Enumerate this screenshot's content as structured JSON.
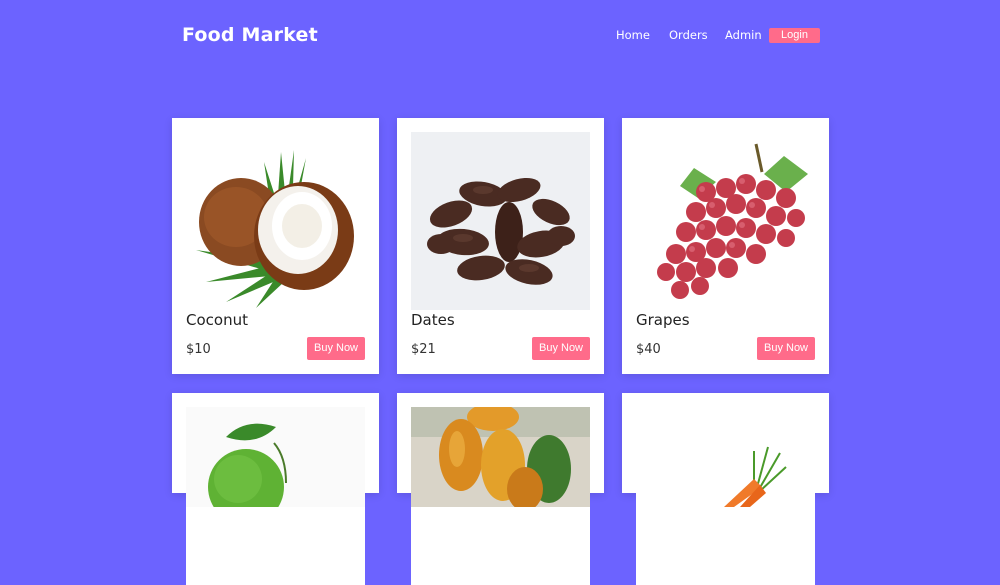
{
  "brand": "Food Market",
  "nav": {
    "home": "Home",
    "orders": "Orders",
    "admin": "Admin",
    "login": "Login"
  },
  "colors": {
    "background": "#6c63ff",
    "accent": "#ff6b8a",
    "card": "#ffffff"
  },
  "products": [
    {
      "name": "Coconut",
      "price": "$10",
      "button": "Buy Now",
      "image": "coconut"
    },
    {
      "name": "Dates",
      "price": "$21",
      "button": "Buy Now",
      "image": "dates"
    },
    {
      "name": "Grapes",
      "price": "$40",
      "button": "Buy Now",
      "image": "grapes"
    },
    {
      "image": "lime"
    },
    {
      "image": "papaya"
    },
    {
      "image": "carrot"
    }
  ]
}
